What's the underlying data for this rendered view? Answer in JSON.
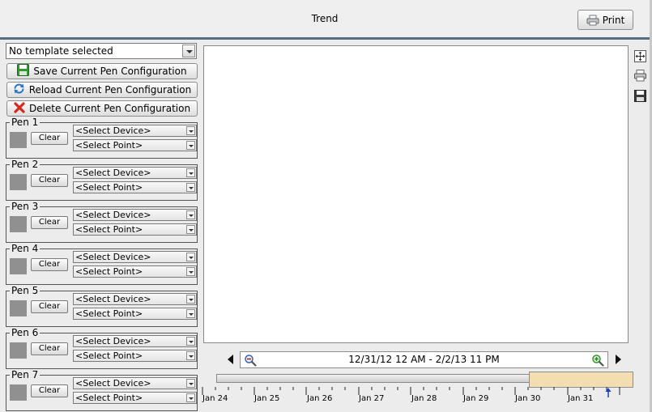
{
  "header": {
    "title": "Trend",
    "print_label": "Print"
  },
  "left_panel": {
    "template_select": {
      "value": "No template selected"
    },
    "save_label": "Save Current Pen Configuration",
    "reload_label": "Reload Current Pen Configuration",
    "delete_label": "Delete Current Pen Configuration"
  },
  "pens": [
    {
      "label": "Pen 1",
      "clear": "Clear",
      "device": "<Select Device>",
      "point": "<Select Point>"
    },
    {
      "label": "Pen 2",
      "clear": "Clear",
      "device": "<Select Device>",
      "point": "<Select Point>"
    },
    {
      "label": "Pen 3",
      "clear": "Clear",
      "device": "<Select Device>",
      "point": "<Select Point>"
    },
    {
      "label": "Pen 4",
      "clear": "Clear",
      "device": "<Select Device>",
      "point": "<Select Point>"
    },
    {
      "label": "Pen 5",
      "clear": "Clear",
      "device": "<Select Device>",
      "point": "<Select Point>"
    },
    {
      "label": "Pen 6",
      "clear": "Clear",
      "device": "<Select Device>",
      "point": "<Select Point>"
    },
    {
      "label": "Pen 7",
      "clear": "Clear",
      "device": "<Select Device>",
      "point": "<Select Point>"
    }
  ],
  "navigator": {
    "range": "12/31/12 12 AM - 2/2/13 11 PM",
    "ticks": [
      "Jan 24",
      "Jan 25",
      "Jan 26",
      "Jan 27",
      "Jan 28",
      "Jan 29",
      "Jan 30",
      "Jan 31"
    ]
  },
  "icons": {
    "print": "printer-icon",
    "save": "floppy-disk-icon",
    "reload": "refresh-icon",
    "delete": "red-x-icon",
    "zoom_out": "zoom-out-icon",
    "zoom_in": "zoom-in-icon",
    "fit": "fit-to-view-icon",
    "chart_print": "printer-icon",
    "chart_save": "floppy-disk-icon"
  },
  "colors": {
    "header_rule": "#566e84",
    "pen_swatch": "#909090",
    "timeline_window": "#f2deb1",
    "now_marker": "#1a3fc4"
  }
}
